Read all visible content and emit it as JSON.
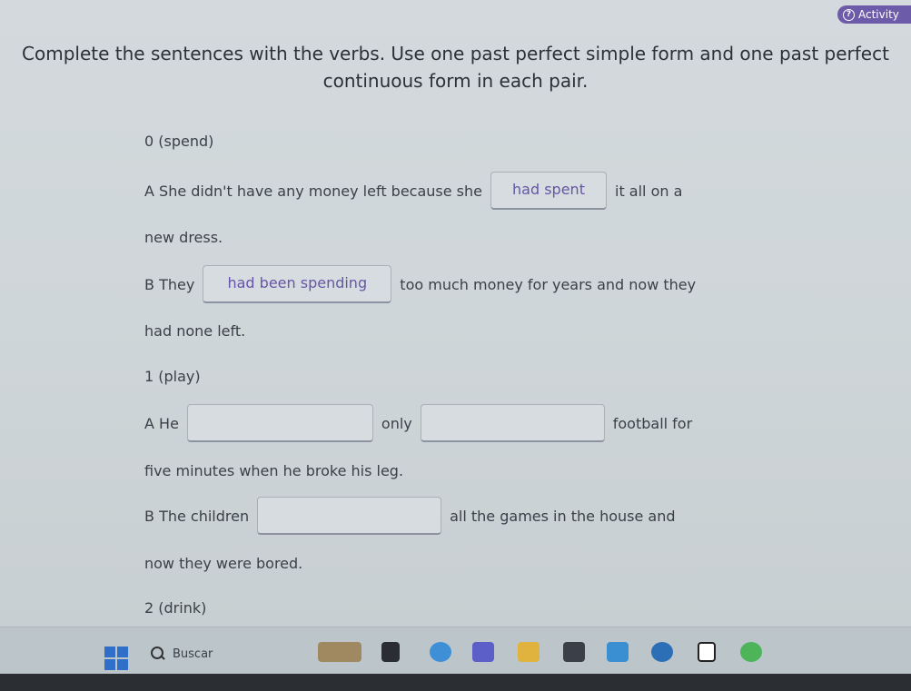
{
  "header": {
    "activity_label": "Activity"
  },
  "instructions": {
    "line1": "Complete the sentences with the verbs. Use one past perfect simple form and one past perfect",
    "line2": "continuous form in each pair."
  },
  "exercise": {
    "item0": {
      "heading": "0 (spend)",
      "a_prefix": "A She didn't have any money left because she",
      "a_answer": "had spent",
      "a_suffix": "it all on a",
      "a_continuation": "new dress.",
      "b_prefix": "B They",
      "b_answer": "had been spending",
      "b_suffix": "too much money for years and now they",
      "b_continuation": "had none left."
    },
    "item1": {
      "heading": "1 (play)",
      "a_prefix": "A He",
      "a_answer1": "",
      "a_middle": "only",
      "a_answer2": "",
      "a_suffix": "football for",
      "a_continuation": "five minutes when he broke his leg.",
      "b_prefix": "B The children",
      "b_answer": "",
      "b_suffix": "all the games in the house and",
      "b_continuation": "now they were bored."
    },
    "item2": {
      "heading": "2 (drink)"
    }
  },
  "taskbar": {
    "search_label": "Buscar",
    "icons": [
      "start-icon",
      "search-icon",
      "widgets-icon",
      "file-explorer-icon",
      "edge-icon",
      "teams-icon",
      "folder-icon",
      "store-icon",
      "app-icon",
      "chrome-icon",
      "notion-icon",
      "browser-icon"
    ]
  },
  "colors": {
    "accent": "#6b5ba8",
    "answer_text": "#6655a8",
    "background": "#d3d9dc"
  }
}
